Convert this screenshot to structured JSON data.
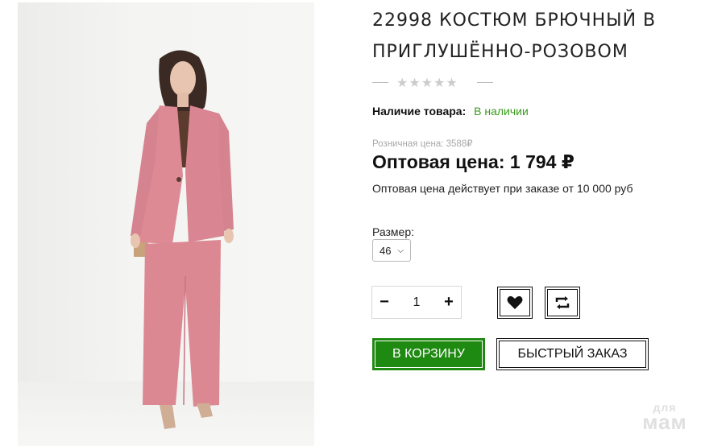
{
  "product": {
    "title": "22998 КОСТЮМ БРЮЧНЫЙ В ПРИГЛУШЁННО-РОЗОВОМ",
    "rating_stars": "★★★★★",
    "rating_value": 0,
    "stock_label": "Наличие товара:",
    "stock_value": "В наличии",
    "retail_price": "Розничная цена: 3588₽",
    "wholesale_price": "Оптовая цена: 1 794 ₽",
    "wholesale_note": "Оптовая цена действует при заказе от 10 000 руб",
    "size_label": "Размер:",
    "size_selected": "46",
    "quantity": "1"
  },
  "actions": {
    "minus": "−",
    "plus": "+",
    "favorite_icon": "heart-icon",
    "compare_icon": "compare-arrows-icon",
    "cart": "В КОРЗИНУ",
    "quick_order": "БЫСТРЫЙ ЗАКАЗ"
  },
  "watermark": {
    "line1": "для",
    "line2": "мам"
  },
  "colors": {
    "in_stock": "#3a9a1b",
    "cart_button": "#1f8a12",
    "suit_pink": "#dd8a95"
  }
}
